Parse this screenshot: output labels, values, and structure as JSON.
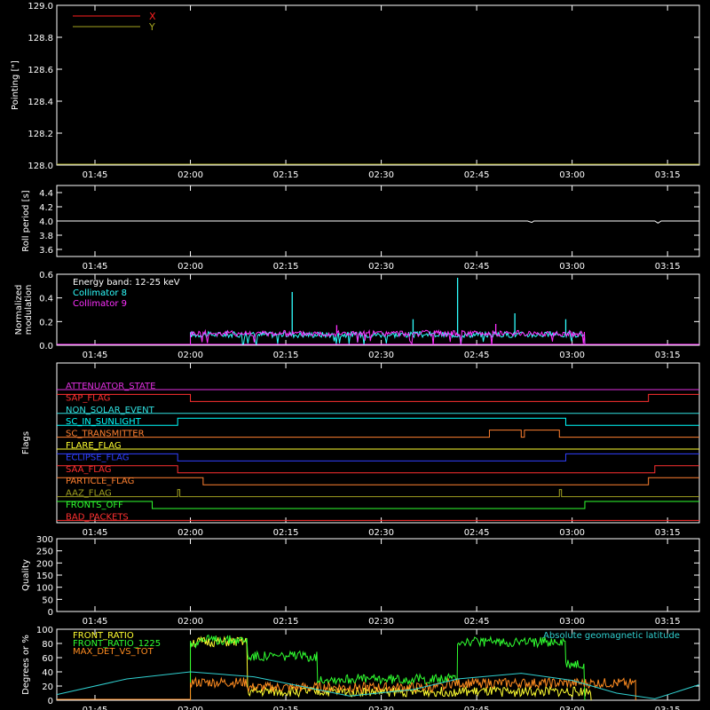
{
  "chart_data": [
    {
      "id": "pointing",
      "type": "line",
      "ylabel": "Pointing [\"]",
      "ylim": [
        128.0,
        129.0
      ],
      "yticks": [
        "128.0",
        "128.2",
        "128.4",
        "128.6",
        "128.8",
        "129.0"
      ],
      "xticks": [
        "01:45",
        "02:00",
        "02:15",
        "02:30",
        "02:45",
        "03:00",
        "03:15"
      ],
      "series": [
        {
          "name": "X",
          "color": "#ff2020",
          "values": []
        },
        {
          "name": "Y",
          "color": "#a5a520",
          "values": []
        }
      ],
      "legend": "top-left"
    },
    {
      "id": "roll",
      "type": "line",
      "ylabel": "Roll period [s]",
      "ylim": [
        3.5,
        4.5
      ],
      "yticks": [
        "3.6",
        "3.8",
        "4.0",
        "4.2",
        "4.4"
      ],
      "xticks": [
        "01:45",
        "02:00",
        "02:15",
        "02:30",
        "02:45",
        "03:00",
        "03:15"
      ],
      "series": [
        {
          "color": "#ffffff",
          "x": [
            "01:39",
            "02:53",
            "02:53:40",
            "02:54",
            "02:55",
            "03:13",
            "03:13:30",
            "03:14",
            "03:20"
          ],
          "values": [
            4.0,
            4.0,
            3.98,
            4.0,
            4.0,
            4.0,
            3.97,
            4.0,
            4.0
          ]
        }
      ]
    },
    {
      "id": "modulation",
      "type": "line",
      "ylabel": "Normalized modulation",
      "ylim": [
        0.0,
        0.6
      ],
      "yticks": [
        "0.0",
        "0.2",
        "0.4",
        "0.6"
      ],
      "xticks": [
        "01:45",
        "02:00",
        "02:15",
        "02:30",
        "02:45",
        "03:00",
        "03:15"
      ],
      "annotation": "Energy band: 12-25 keV",
      "series": [
        {
          "name": "Collimator 8",
          "color": "#30ffff",
          "baseline": 0.09,
          "spikes": [
            [
              "02:16",
              0.45
            ],
            [
              "02:42",
              0.57
            ],
            [
              "02:51",
              0.27
            ],
            [
              "02:35",
              0.22
            ],
            [
              "02:59",
              0.22
            ]
          ]
        },
        {
          "name": "Collimator 9",
          "color": "#ff30ff",
          "baseline": 0.1,
          "spikes": [
            [
              "02:23",
              0.17
            ],
            [
              "02:48",
              0.18
            ]
          ]
        }
      ],
      "active_range": [
        "02:00",
        "03:02"
      ],
      "legend": "top-left"
    },
    {
      "id": "flags",
      "type": "line",
      "ylabel": "Flags",
      "xticks": [
        "01:45",
        "02:00",
        "02:15",
        "02:30",
        "02:45",
        "03:00",
        "03:15"
      ],
      "series": [
        {
          "name": "ATTENUATOR_STATE",
          "color": "#e030e0",
          "steps": [
            [
              "01:39",
              0
            ]
          ]
        },
        {
          "name": "SAP_FLAG",
          "color": "#ff3030",
          "steps": [
            [
              "01:39",
              1
            ],
            [
              "02:00",
              0
            ],
            [
              "03:12",
              1
            ]
          ]
        },
        {
          "name": "NON_SOLAR_EVENT",
          "color": "#30e0e0",
          "steps": [
            [
              "01:39",
              0
            ]
          ]
        },
        {
          "name": "SC_IN_SUNLIGHT",
          "color": "#00ffff",
          "steps": [
            [
              "01:39",
              0
            ],
            [
              "01:58",
              1
            ],
            [
              "02:59",
              0
            ]
          ]
        },
        {
          "name": "SC_TRANSMITTER",
          "color": "#ff8030",
          "steps": [
            [
              "01:39",
              0
            ],
            [
              "02:47",
              1
            ],
            [
              "02:52",
              0
            ],
            [
              "02:52:30",
              1
            ],
            [
              "02:58",
              0
            ]
          ]
        },
        {
          "name": "FLARE_FLAG",
          "color": "#ffff30",
          "steps": [
            [
              "01:39",
              0
            ]
          ]
        },
        {
          "name": "ECLIPSE_FLAG",
          "color": "#3040ff",
          "steps": [
            [
              "01:39",
              1
            ],
            [
              "01:58",
              0
            ],
            [
              "02:59",
              1
            ]
          ]
        },
        {
          "name": "SAA_FLAG",
          "color": "#ff3030",
          "steps": [
            [
              "01:39",
              1
            ],
            [
              "01:58",
              0
            ],
            [
              "03:13",
              1
            ]
          ]
        },
        {
          "name": "PARTICLE_FLAG",
          "color": "#ff8030",
          "steps": [
            [
              "01:39",
              1
            ],
            [
              "02:02",
              0
            ],
            [
              "03:12",
              1
            ]
          ]
        },
        {
          "name": "AAZ_FLAG",
          "color": "#a0a020",
          "steps": [
            [
              "01:39",
              0
            ],
            [
              "01:58",
              1
            ],
            [
              "01:58:20",
              0
            ],
            [
              "02:58",
              1
            ],
            [
              "02:58:20",
              0
            ]
          ]
        },
        {
          "name": "FRONTS_OFF",
          "color": "#30ff30",
          "steps": [
            [
              "01:39",
              1
            ],
            [
              "01:54",
              0
            ],
            [
              "03:02",
              1
            ]
          ]
        },
        {
          "name": "BAD_PACKETS",
          "color": "#ff3030",
          "steps": [
            [
              "01:39",
              0
            ]
          ]
        }
      ]
    },
    {
      "id": "quality",
      "type": "line",
      "ylabel": "Quality",
      "ylim": [
        0,
        300
      ],
      "yticks": [
        "0",
        "50",
        "100",
        "150",
        "200",
        "250",
        "300"
      ],
      "xticks": [
        "01:45",
        "02:00",
        "02:15",
        "02:30",
        "02:45",
        "03:00",
        "03:15"
      ],
      "series": []
    },
    {
      "id": "ratios",
      "type": "line",
      "ylabel": "Degrees or %",
      "ylim": [
        0,
        100
      ],
      "yticks": [
        "0",
        "20",
        "40",
        "60",
        "80",
        "100"
      ],
      "xticks": [
        "01:45",
        "02:00",
        "02:15",
        "02:30",
        "02:45",
        "03:00",
        "03:15"
      ],
      "series": [
        {
          "name": "FRONT_RATIO",
          "color": "#ffff30",
          "segments": [
            [
              "02:00",
              "02:09",
              82
            ],
            [
              "02:09",
              "03:03",
              12
            ]
          ]
        },
        {
          "name": "FRONT_RATIO_1225",
          "color": "#30ff30",
          "segments": [
            [
              "02:00",
              "02:01",
              80
            ],
            [
              "02:01",
              "02:09",
              85
            ],
            [
              "02:09",
              "02:20",
              62
            ],
            [
              "02:20",
              "02:42",
              30
            ],
            [
              "02:42",
              "02:59",
              82
            ],
            [
              "02:59",
              "03:02",
              50
            ]
          ]
        },
        {
          "name": "MAX_DET_VS_TOT",
          "color": "#ff8c20",
          "segments": [
            [
              "02:00",
              "02:09",
              25
            ],
            [
              "02:09",
              "02:40",
              18
            ],
            [
              "02:40",
              "03:10",
              24
            ]
          ]
        },
        {
          "name": "Absolute geomagnetic latitude",
          "color": "#30d0d0",
          "x": [
            "01:39",
            "01:50",
            "02:00",
            "02:10",
            "02:20",
            "02:25",
            "02:35",
            "02:42",
            "02:52",
            "03:00",
            "03:07",
            "03:13",
            "03:20"
          ],
          "values": [
            8,
            30,
            40,
            33,
            15,
            6,
            15,
            30,
            38,
            28,
            10,
            2,
            22
          ]
        }
      ],
      "legend": "top-left"
    }
  ]
}
